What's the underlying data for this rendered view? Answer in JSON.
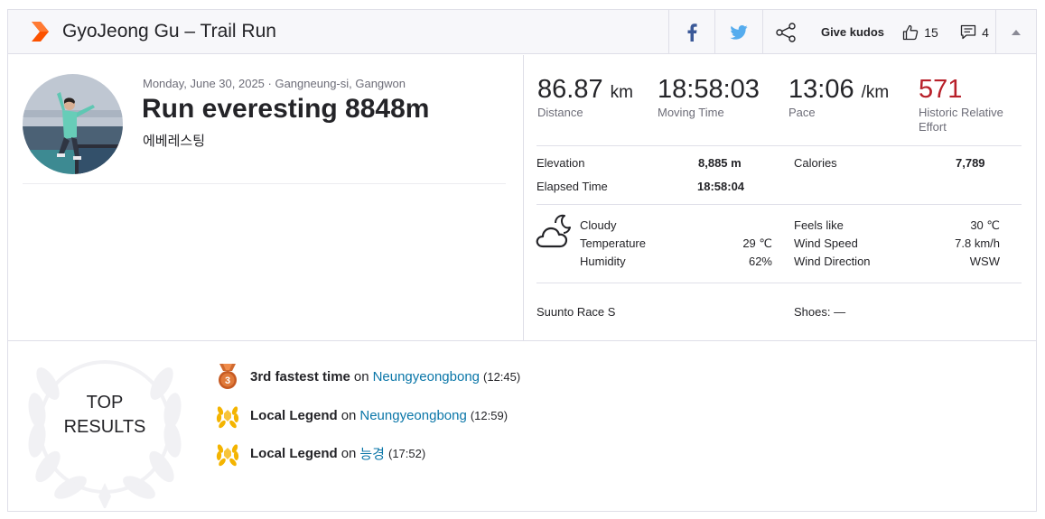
{
  "header": {
    "title": "GyoJeong Gu – Trail Run",
    "give_kudos_label": "Give kudos",
    "kudos_count": "15",
    "comments_count": "4"
  },
  "activity": {
    "meta": "Monday, June 30, 2025 · Gangneung-si, Gangwon",
    "name": "Run everesting 8848m",
    "description": "에베레스팅"
  },
  "stats": [
    {
      "value": "86.87",
      "unit": "km",
      "label": "Distance"
    },
    {
      "value": "18:58:03",
      "unit": "",
      "label": "Moving Time"
    },
    {
      "value": "13:06",
      "unit": "/km",
      "label": "Pace"
    },
    {
      "value": "571",
      "unit": "",
      "label": "Historic Relative Effort"
    }
  ],
  "details": {
    "elevation_label": "Elevation",
    "elevation_value": "8,885 m",
    "calories_label": "Calories",
    "calories_value": "7,789",
    "elapsed_label": "Elapsed Time",
    "elapsed_value": "18:58:04"
  },
  "weather": {
    "condition": "Cloudy",
    "temperature_label": "Temperature",
    "temperature_value": "29 ℃",
    "humidity_label": "Humidity",
    "humidity_value": "62%",
    "feels_like_label": "Feels like",
    "feels_like_value": "30 ℃",
    "wind_speed_label": "Wind Speed",
    "wind_speed_value": "7.8 km/h",
    "wind_direction_label": "Wind Direction",
    "wind_direction_value": "WSW"
  },
  "gear": {
    "device": "Suunto Race S",
    "shoes": "Shoes: —"
  },
  "top_results": {
    "title_line1": "TOP",
    "title_line2": "RESULTS",
    "items": [
      {
        "achievement": "3rd fastest time",
        "on": "on",
        "segment": "Neungyeongbong",
        "time": "(12:45)",
        "medal": "bronze-medal-3"
      },
      {
        "achievement": "Local Legend",
        "on": "on",
        "segment": "Neungyeongbong",
        "time": "(12:59)",
        "medal": "local-legend-laurel"
      },
      {
        "achievement": "Local Legend",
        "on": "on",
        "segment": "능경",
        "time": "(17:52)",
        "medal": "local-legend-laurel"
      }
    ]
  },
  "colors": {
    "brand_orange": "#fc5200",
    "link_blue": "#0a76a8",
    "facebook_blue": "#3b5998",
    "twitter_blue": "#55acee",
    "relative_effort_red": "#b8202a",
    "legend_gold": "#f4b400"
  }
}
